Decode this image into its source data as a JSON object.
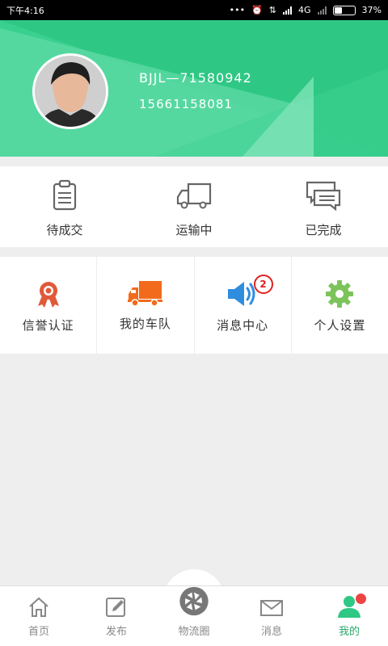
{
  "status_bar": {
    "time": "下午4:16",
    "network": "4G",
    "battery": "37%"
  },
  "profile": {
    "user_id": "BJJL—71580942",
    "phone": "15661158081"
  },
  "orders": [
    {
      "label": "待成交",
      "icon": "clipboard-icon"
    },
    {
      "label": "运输中",
      "icon": "truck-outline-icon"
    },
    {
      "label": "已完成",
      "icon": "chat-bubbles-icon"
    }
  ],
  "features": [
    {
      "label": "信誉认证",
      "icon": "award-ribbon-icon"
    },
    {
      "label": "我的车队",
      "icon": "truck-icon"
    },
    {
      "label": "消息中心",
      "icon": "speaker-icon",
      "badge": "2"
    },
    {
      "label": "个人设置",
      "icon": "gear-icon"
    }
  ],
  "tabs": [
    {
      "label": "首页",
      "icon": "home-icon"
    },
    {
      "label": "发布",
      "icon": "edit-icon"
    },
    {
      "label": "物流圈",
      "icon": "aperture-icon"
    },
    {
      "label": "消息",
      "icon": "mail-icon"
    },
    {
      "label": "我的",
      "icon": "user-icon",
      "active": true
    }
  ],
  "colors": {
    "accent": "#2ec884",
    "badge": "#e02020",
    "award": "#e05a3a",
    "truck": "#f26a1b",
    "speaker": "#2f8ddf",
    "gear": "#7cc45a"
  }
}
